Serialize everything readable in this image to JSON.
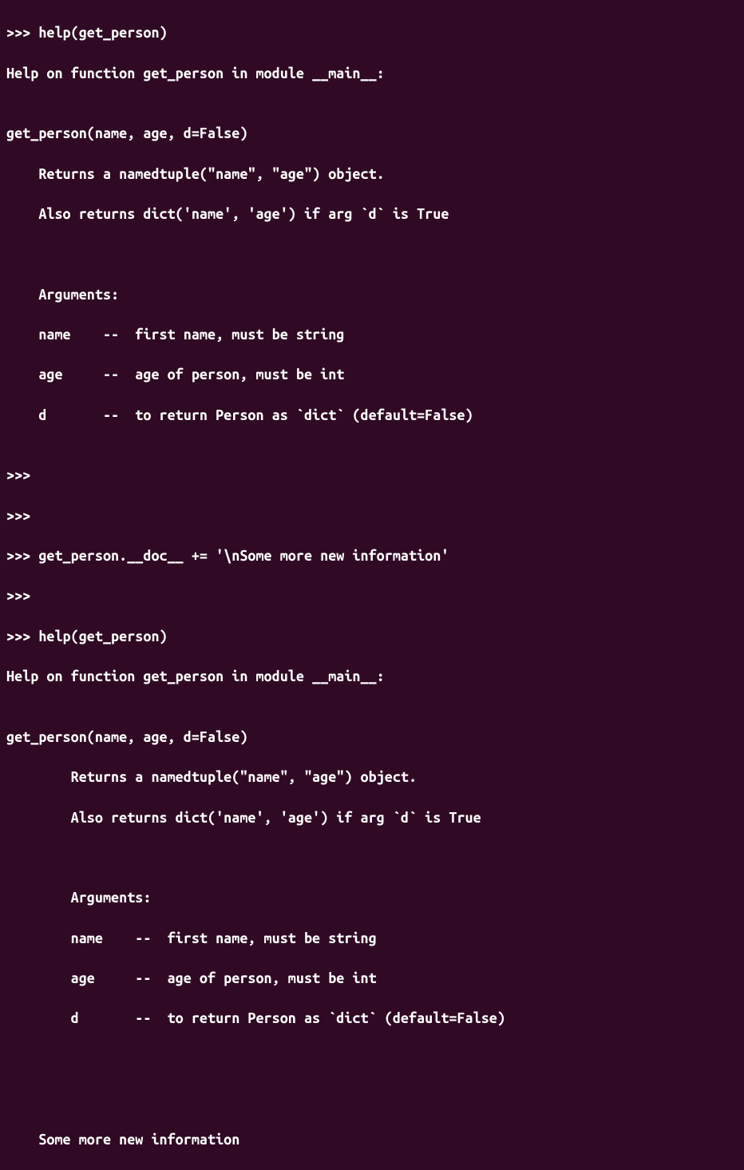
{
  "prompt": ">>>",
  "lines": [
    ">>> help(get_person)",
    "Help on function get_person in module __main__:",
    "",
    "get_person(name, age, d=False)",
    "    Returns a namedtuple(\"name\", \"age\") object.",
    "    Also returns dict('name', 'age') if arg `d` is True",
    "    ",
    "    Arguments:",
    "    name    --  first name, must be string",
    "    age     --  age of person, must be int",
    "    d       --  to return Person as `dict` (default=False)",
    "",
    ">>> ",
    ">>> ",
    ">>> get_person.__doc__ += '\\nSome more new information'",
    ">>> ",
    ">>> help(get_person)",
    "Help on function get_person in module __main__:",
    "",
    "get_person(name, age, d=False)",
    "        Returns a namedtuple(\"name\", \"age\") object.",
    "        Also returns dict('name', 'age') if arg `d` is True",
    "    ",
    "        Arguments:",
    "        name    --  first name, must be string",
    "        age     --  age of person, must be int",
    "        d       --  to return Person as `dict` (default=False)",
    "    ",
    "    ",
    "    Some more new information"
  ]
}
